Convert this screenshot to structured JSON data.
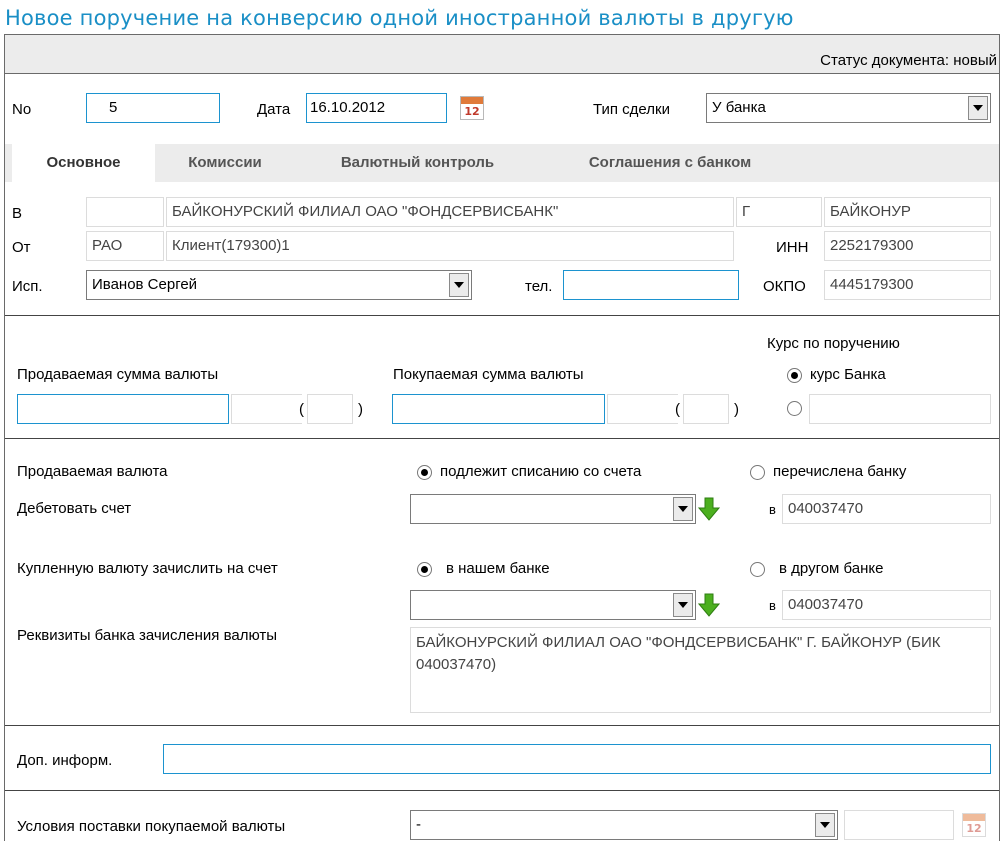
{
  "title": "Новое поручение на конверсию одной иностранной валюты в другую",
  "status": "Статус документа: новый",
  "header": {
    "no_label": "No",
    "no_value": "5",
    "date_label": "Дата",
    "date_value": "16.10.2012",
    "calendar_number": "12",
    "deal_type_label": "Тип сделки",
    "deal_type_value": "У банка"
  },
  "tabs": [
    {
      "label": "Основное",
      "active": true
    },
    {
      "label": "Комиссии",
      "active": false
    },
    {
      "label": "Валютный контроль",
      "active": false
    },
    {
      "label": "Соглашения с банком",
      "active": false
    }
  ],
  "main": {
    "to_label": "В",
    "to_code": "",
    "to_bank": "БАЙКОНУРСКИЙ ФИЛИАЛ ОАО \"ФОНДСЕРВИСБАНК\"",
    "to_city_type": "Г",
    "to_city": "БАЙКОНУР",
    "from_label": "От",
    "from_code": "РАО",
    "from_client": "Клиент(179300)1",
    "inn_label": "ИНН",
    "inn_value": "2252179300",
    "exec_label": "Исп.",
    "exec_value": "Иванов Сергей",
    "phone_label": "тел.",
    "phone_value": "",
    "okpo_label": "ОКПО",
    "okpo_value": "4445179300"
  },
  "amounts": {
    "rate_title": "Курс по поручению",
    "sell_label": "Продаваемая сумма валюты",
    "sell_value": "",
    "sell_currency": "",
    "sell_paren_open": "(",
    "sell_paren_close": ")",
    "buy_label": "Покупаемая сумма валюты",
    "buy_value": "",
    "buy_currency": "",
    "buy_paren_open": "(",
    "buy_paren_close": ")",
    "rate_bank_label": "курс Банка",
    "rate_custom_value": ""
  },
  "currency": {
    "sold_label": "Продаваемая валюта",
    "debit_option": "подлежит списанию со счета",
    "transfer_option": "перечислена банку",
    "debit_account_label": "Дебетовать счет",
    "debit_account_value": "",
    "in_label": "в",
    "debit_bik": "040037470",
    "credit_label": "Купленную валюту зачислить на счет",
    "our_bank_option": "в нашем банке",
    "other_bank_option": "в другом банке",
    "credit_account_value": "",
    "credit_bik": "040037470",
    "bank_details_label": "Реквизиты банка зачисления валюты",
    "bank_details_value": "БАЙКОНУРСКИЙ ФИЛИАЛ ОАО \"ФОНДСЕРВИСБАНК\" Г. БАЙКОНУР (БИК 040037470)"
  },
  "extra": {
    "label": "Доп. информ.",
    "value": ""
  },
  "delivery": {
    "label": "Условия поставки покупаемой валюты",
    "value": "-",
    "date_value": ""
  },
  "colors": {
    "title": "#1a8fc6",
    "input_border": "#1c93cf",
    "arrow": "#4caf1f"
  }
}
